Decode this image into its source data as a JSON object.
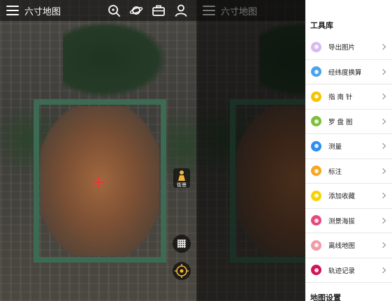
{
  "app": {
    "title": "六寸地图"
  },
  "map": {
    "streetview_label": "街景"
  },
  "drawer": {
    "section_tools": "工具库",
    "tools": [
      {
        "label": "导出图片",
        "icon": "export-image-icon",
        "color": "#d8b9f0"
      },
      {
        "label": "经纬度换算",
        "icon": "coordinate-convert-icon",
        "color": "#4aa3e8"
      },
      {
        "label": "指 南 针",
        "icon": "compass-icon",
        "color": "#f5c400"
      },
      {
        "label": "罗 盘 图",
        "icon": "luopan-icon",
        "color": "#7bbf3b"
      },
      {
        "label": "测量",
        "icon": "measure-icon",
        "color": "#2f8ff0"
      },
      {
        "label": "标注",
        "icon": "marker-pin-icon",
        "color": "#f5a623"
      },
      {
        "label": "添加收藏",
        "icon": "favorite-star-icon",
        "color": "#f8d200"
      },
      {
        "label": "测景海拔",
        "icon": "altitude-icon",
        "color": "#e64a7b"
      },
      {
        "label": "离线地图",
        "icon": "offline-map-icon",
        "color": "#f29aa8"
      },
      {
        "label": "轨迹记录",
        "icon": "track-record-icon",
        "color": "#d4145a"
      }
    ],
    "section_map_settings": "地图设置"
  }
}
